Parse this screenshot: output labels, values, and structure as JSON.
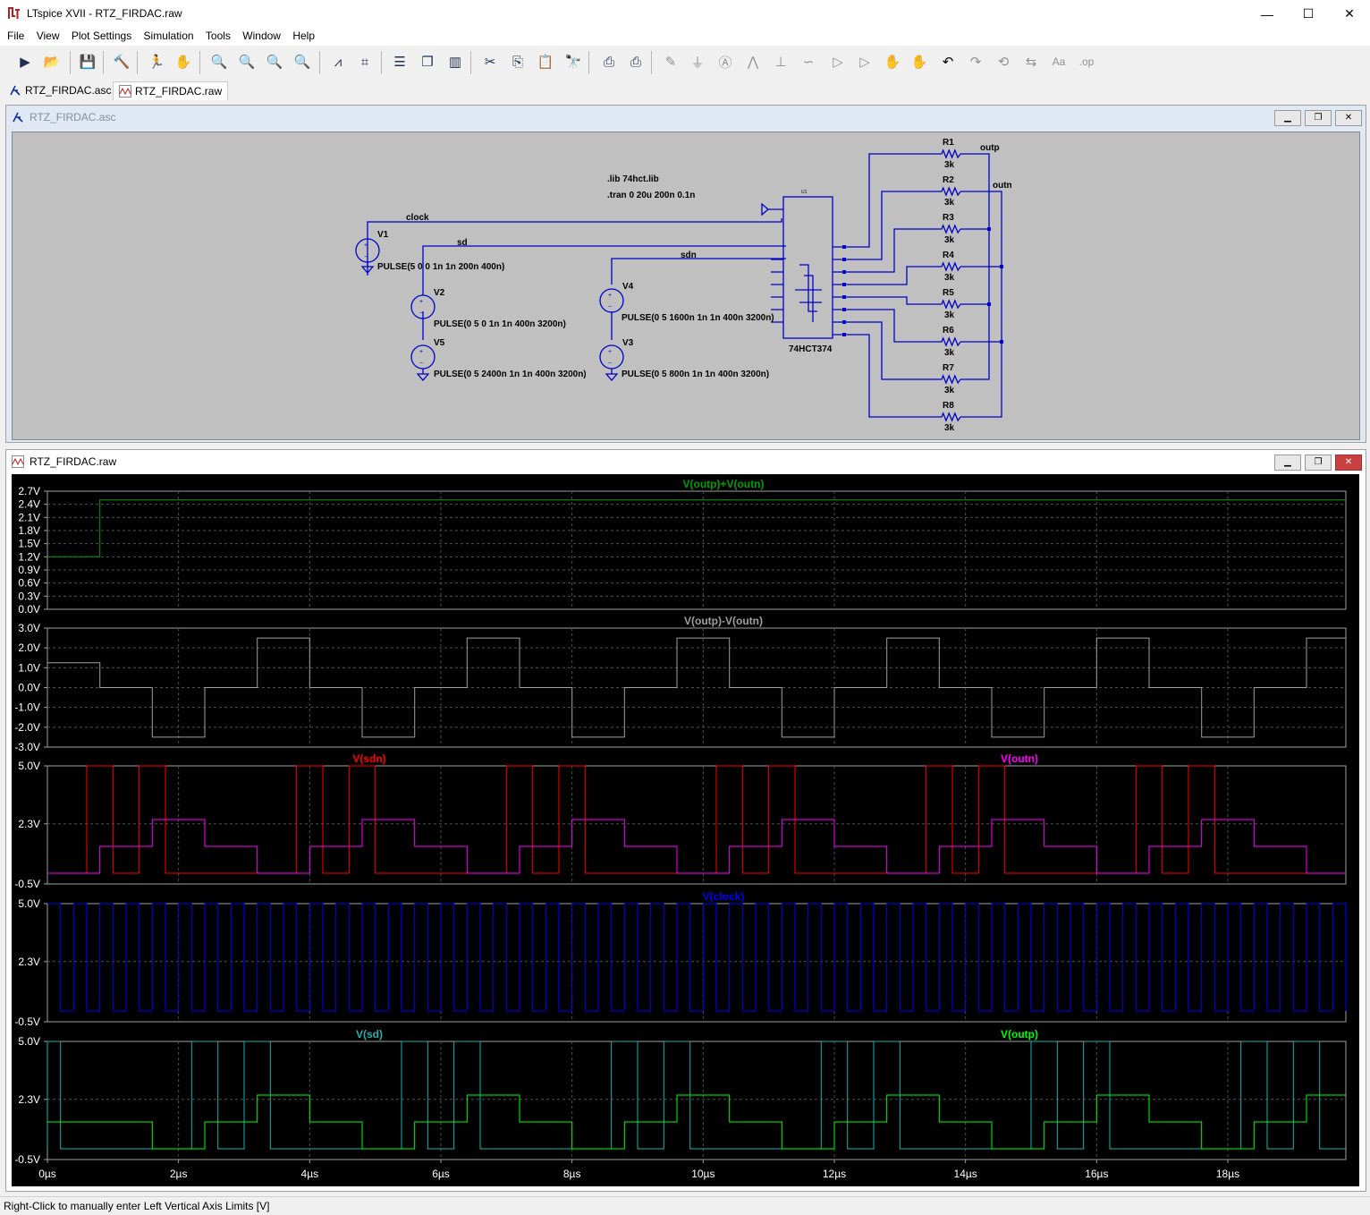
{
  "window": {
    "title": "LTspice XVII - RTZ_FIRDAC.raw",
    "minimize": "—",
    "maximize": "☐",
    "close": "✕"
  },
  "menu": [
    "File",
    "View",
    "Plot Settings",
    "Simulation",
    "Tools",
    "Window",
    "Help"
  ],
  "toolbar_icons": [
    "run-icon",
    "open-icon",
    "save-icon",
    "control-panel-icon",
    "halt-icon",
    "pan-hand-icon",
    "zoom-in-icon",
    "zoom-fit-icon",
    "zoom-out-icon",
    "zoom-cancel-icon",
    "autorange-icon",
    "cursor-icon",
    "tile-horizontal-icon",
    "cascade-icon",
    "tile-vertical-icon",
    "cut-icon",
    "copy-icon",
    "paste-icon",
    "find-icon",
    "print-preview-icon",
    "print-icon",
    "wire-icon",
    "ground-icon",
    "label-net-icon",
    "resistor-icon",
    "capacitor-icon",
    "inductor-icon",
    "diode-icon",
    "component-icon",
    "move-icon",
    "drag-icon",
    "undo-icon",
    "redo-icon",
    "rotate-icon",
    "mirror-icon",
    "text-icon",
    "spice-directive-icon"
  ],
  "tabs": [
    {
      "label": "RTZ_FIRDAC.asc"
    },
    {
      "label": "RTZ_FIRDAC.raw"
    }
  ],
  "schematic": {
    "title": "RTZ_FIRDAC.asc",
    "directives": [
      ".lib 74hct.lib",
      ".tran 0 20u 200n 0.1n"
    ],
    "nets": [
      "clock",
      "sd",
      "sdn",
      "outp",
      "outn"
    ],
    "sources": [
      {
        "name": "V1",
        "value": "PULSE(5 0 0 1n 1n 200n 400n)"
      },
      {
        "name": "V2",
        "value": "PULSE(0 5 0 1n 1n 400n 3200n)"
      },
      {
        "name": "V5",
        "value": "PULSE(0 5 2400n 1n 1n 400n 3200n)"
      },
      {
        "name": "V4",
        "value": "PULSE(0 5 1600n 1n 1n 400n 3200n)"
      },
      {
        "name": "V3",
        "value": "PULSE(0 5 800n 1n 1n 400n 3200n)"
      }
    ],
    "ic": {
      "ref": "U1",
      "part": "74HCT374"
    },
    "resistors": [
      {
        "name": "R1",
        "value": "3k"
      },
      {
        "name": "R2",
        "value": "3k"
      },
      {
        "name": "R3",
        "value": "3k"
      },
      {
        "name": "R4",
        "value": "3k"
      },
      {
        "name": "R5",
        "value": "3k"
      },
      {
        "name": "R6",
        "value": "3k"
      },
      {
        "name": "R7",
        "value": "3k"
      },
      {
        "name": "R8",
        "value": "3k"
      }
    ]
  },
  "waveform": {
    "title": "RTZ_FIRDAC.raw",
    "x_ticks": [
      "0µs",
      "2µs",
      "4µs",
      "6µs",
      "8µs",
      "10µs",
      "12µs",
      "14µs",
      "16µs",
      "18µs"
    ],
    "panes": [
      {
        "traces": [
          {
            "name": "V(outp)+V(outn)",
            "color": "#00a000"
          }
        ],
        "y_ticks": [
          "2.7V",
          "2.4V",
          "2.1V",
          "1.8V",
          "1.5V",
          "1.2V",
          "0.9V",
          "0.6V",
          "0.3V",
          "0.0V"
        ]
      },
      {
        "traces": [
          {
            "name": "V(outp)-V(outn)",
            "color": "#a0a0a0"
          }
        ],
        "y_ticks": [
          "3.0V",
          "2.0V",
          "1.0V",
          "0.0V",
          "-1.0V",
          "-2.0V",
          "-3.0V"
        ]
      },
      {
        "traces": [
          {
            "name": "V(sdn)",
            "color": "#ff0000"
          },
          {
            "name": "V(outn)",
            "color": "#ff00ff"
          }
        ],
        "y_ticks": [
          "5.0V",
          "2.3V",
          "-0.5V"
        ]
      },
      {
        "traces": [
          {
            "name": "V(clock)",
            "color": "#0000ff"
          }
        ],
        "y_ticks": [
          "5.0V",
          "2.3V",
          "-0.5V"
        ]
      },
      {
        "traces": [
          {
            "name": "V(sd)",
            "color": "#20b0b0"
          },
          {
            "name": "V(outp)",
            "color": "#00ff00"
          }
        ],
        "y_ticks": [
          "5.0V",
          "2.3V",
          "-0.5V"
        ]
      }
    ]
  },
  "chart_data": {
    "type": "line",
    "x_unit": "µs",
    "xlim": [
      0,
      19.8
    ],
    "series": [
      {
        "name": "V(outp)+V(outn)",
        "x": [
          0,
          0.8,
          0.8,
          19.8
        ],
        "values": [
          1.2,
          1.2,
          2.5,
          2.5
        ]
      },
      {
        "name": "V(outp)-V(outn)",
        "x": [
          0,
          0.8,
          0.8,
          1.6,
          1.6,
          2.4,
          2.4,
          3.2,
          3.2,
          4.0,
          4.0,
          4.8,
          4.8,
          5.6,
          5.6,
          6.4,
          6.4,
          7.2,
          7.2,
          8.0,
          8.0,
          8.8,
          8.8,
          9.6,
          9.6,
          10.4,
          10.4,
          11.2,
          11.2,
          12.0,
          12.0,
          12.8,
          12.8,
          13.6,
          13.6,
          14.4,
          14.4,
          15.2,
          15.2,
          16.0,
          16.0,
          16.8,
          16.8,
          17.6,
          17.6,
          18.4,
          18.4,
          19.2,
          19.2,
          19.8
        ],
        "values": [
          1.25,
          1.25,
          0,
          0,
          -2.5,
          -2.5,
          0,
          0,
          2.5,
          2.5,
          0,
          0,
          -2.5,
          -2.5,
          0,
          0,
          2.5,
          2.5,
          0,
          0,
          -2.5,
          -2.5,
          0,
          0,
          2.5,
          2.5,
          0,
          0,
          -2.5,
          -2.5,
          0,
          0,
          2.5,
          2.5,
          0,
          0,
          -2.5,
          -2.5,
          0,
          0,
          2.5,
          2.5,
          0,
          0,
          -2.5,
          -2.5,
          0,
          0,
          2.5,
          2.5
        ]
      },
      {
        "name": "V(outn)",
        "x": [
          0,
          0.8,
          0.8,
          1.6,
          1.6,
          2.4,
          2.4,
          3.2,
          3.2,
          4.0,
          4.0,
          4.8,
          4.8,
          5.6,
          5.6,
          6.4,
          6.4,
          7.2,
          7.2,
          8.0,
          8.0,
          8.8,
          8.8,
          9.6,
          9.6,
          10.4,
          10.4,
          11.2,
          11.2,
          12.0,
          12.0,
          12.8,
          12.8,
          13.6,
          13.6,
          14.4,
          14.4,
          15.2,
          15.2,
          16.0,
          16.0,
          16.8,
          16.8,
          17.6,
          17.6,
          18.4,
          18.4,
          19.2,
          19.2,
          19.8
        ],
        "values": [
          0,
          0,
          1.25,
          1.25,
          2.5,
          2.5,
          1.25,
          1.25,
          0,
          0,
          1.25,
          1.25,
          2.5,
          2.5,
          1.25,
          1.25,
          0,
          0,
          1.25,
          1.25,
          2.5,
          2.5,
          1.25,
          1.25,
          0,
          0,
          1.25,
          1.25,
          2.5,
          2.5,
          1.25,
          1.25,
          0,
          0,
          1.25,
          1.25,
          2.5,
          2.5,
          1.25,
          1.25,
          0,
          0,
          1.25,
          1.25,
          2.5,
          2.5,
          1.25,
          1.25,
          0,
          0
        ]
      },
      {
        "name": "V(outp)",
        "x": [
          0,
          1.6,
          1.6,
          2.4,
          2.4,
          3.2,
          3.2,
          4.0,
          4.0,
          4.8,
          4.8,
          5.6,
          5.6,
          6.4,
          6.4,
          7.2,
          7.2,
          8.0,
          8.0,
          8.8,
          8.8,
          9.6,
          9.6,
          10.4,
          10.4,
          11.2,
          11.2,
          12.0,
          12.0,
          12.8,
          12.8,
          13.6,
          13.6,
          14.4,
          14.4,
          15.2,
          15.2,
          16.0,
          16.0,
          16.8,
          16.8,
          17.6,
          17.6,
          18.4,
          18.4,
          19.2,
          19.2,
          19.8
        ],
        "values": [
          1.25,
          1.25,
          0,
          0,
          1.25,
          1.25,
          2.5,
          2.5,
          1.25,
          1.25,
          0,
          0,
          1.25,
          1.25,
          2.5,
          2.5,
          1.25,
          1.25,
          0,
          0,
          1.25,
          1.25,
          2.5,
          2.5,
          1.25,
          1.25,
          0,
          0,
          1.25,
          1.25,
          2.5,
          2.5,
          1.25,
          1.25,
          0,
          0,
          1.25,
          1.25,
          2.5,
          2.5,
          1.25,
          1.25,
          0,
          0,
          1.25,
          1.25,
          2.5,
          2.5
        ]
      },
      {
        "name": "V(sdn)",
        "pulses_high": [
          [
            0.6,
            1.0
          ],
          [
            1.4,
            1.8
          ],
          [
            3.8,
            4.2
          ],
          [
            4.6,
            5.0
          ],
          [
            7.0,
            7.4
          ],
          [
            7.8,
            8.2
          ],
          [
            10.2,
            10.6
          ],
          [
            11.0,
            11.4
          ],
          [
            13.4,
            13.8
          ],
          [
            14.2,
            14.6
          ],
          [
            16.6,
            17.0
          ],
          [
            17.4,
            17.8
          ]
        ]
      },
      {
        "name": "V(sd)",
        "pulses_high": [
          [
            0,
            0.2
          ],
          [
            2.2,
            2.6
          ],
          [
            3.0,
            3.4
          ],
          [
            5.4,
            5.8
          ],
          [
            6.2,
            6.6
          ],
          [
            8.6,
            9.0
          ],
          [
            9.4,
            9.8
          ],
          [
            11.8,
            12.2
          ],
          [
            12.6,
            13.0
          ],
          [
            15.0,
            15.4
          ],
          [
            15.8,
            16.2
          ],
          [
            18.2,
            18.6
          ],
          [
            19.0,
            19.4
          ]
        ]
      },
      {
        "name": "V(clock)",
        "period": 0.4,
        "high_time": 0.2,
        "low": 0,
        "high": 5
      }
    ]
  },
  "status": {
    "text": "Right-Click to manually enter Left Vertical Axis Limits [V]"
  }
}
